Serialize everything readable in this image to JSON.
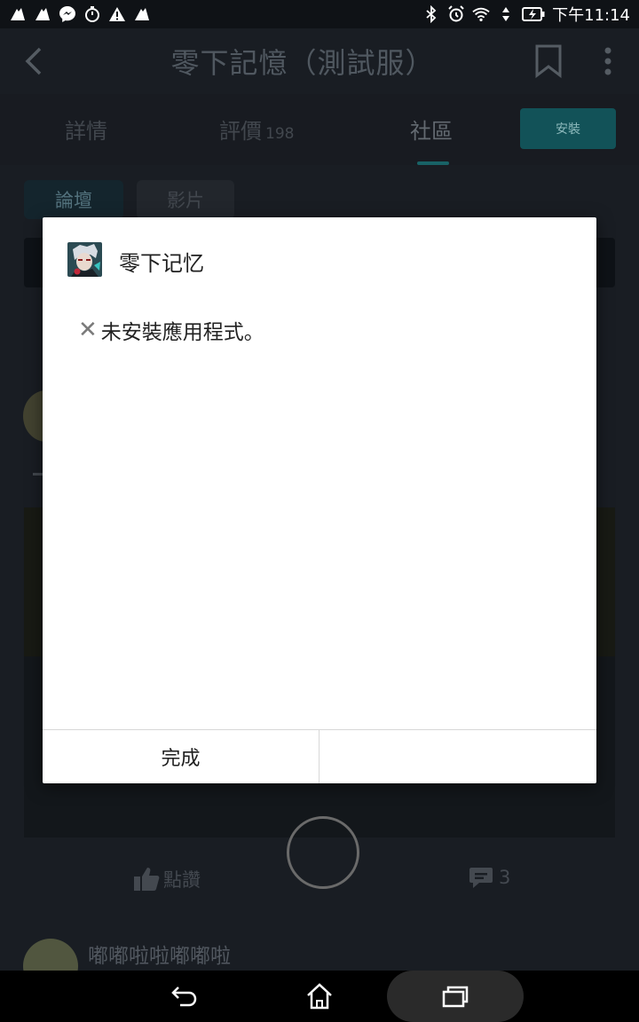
{
  "status_bar": {
    "time": "下午11:14",
    "icons_left": [
      "game-icon",
      "game-icon",
      "messenger-icon",
      "timer-icon",
      "warning-icon",
      "game-icon"
    ],
    "icons_right": [
      "bluetooth-icon",
      "alarm-icon",
      "wifi-icon",
      "data-arrows-icon",
      "battery-charging-icon"
    ]
  },
  "app_bar": {
    "title": "零下記憶（測試服）"
  },
  "tabs": [
    {
      "label": "詳情",
      "count": ""
    },
    {
      "label": "評價",
      "count": "198"
    },
    {
      "label": "社區",
      "count": "",
      "active": true
    }
  ],
  "install_label": "安裝",
  "sub_tabs": [
    "論壇",
    "影片"
  ],
  "post_actions": {
    "like_label": "點讚",
    "comment_count": "3"
  },
  "commenter": {
    "name": "嘟嘟啦啦嘟嘟啦"
  },
  "dialog": {
    "app_name": "零下记忆",
    "message": "未安裝應用程式。",
    "done_label": "完成",
    "second_label": ""
  },
  "colors": {
    "accent": "#155c62",
    "background": "#1c2128",
    "dialog_bg": "#ffffff"
  }
}
